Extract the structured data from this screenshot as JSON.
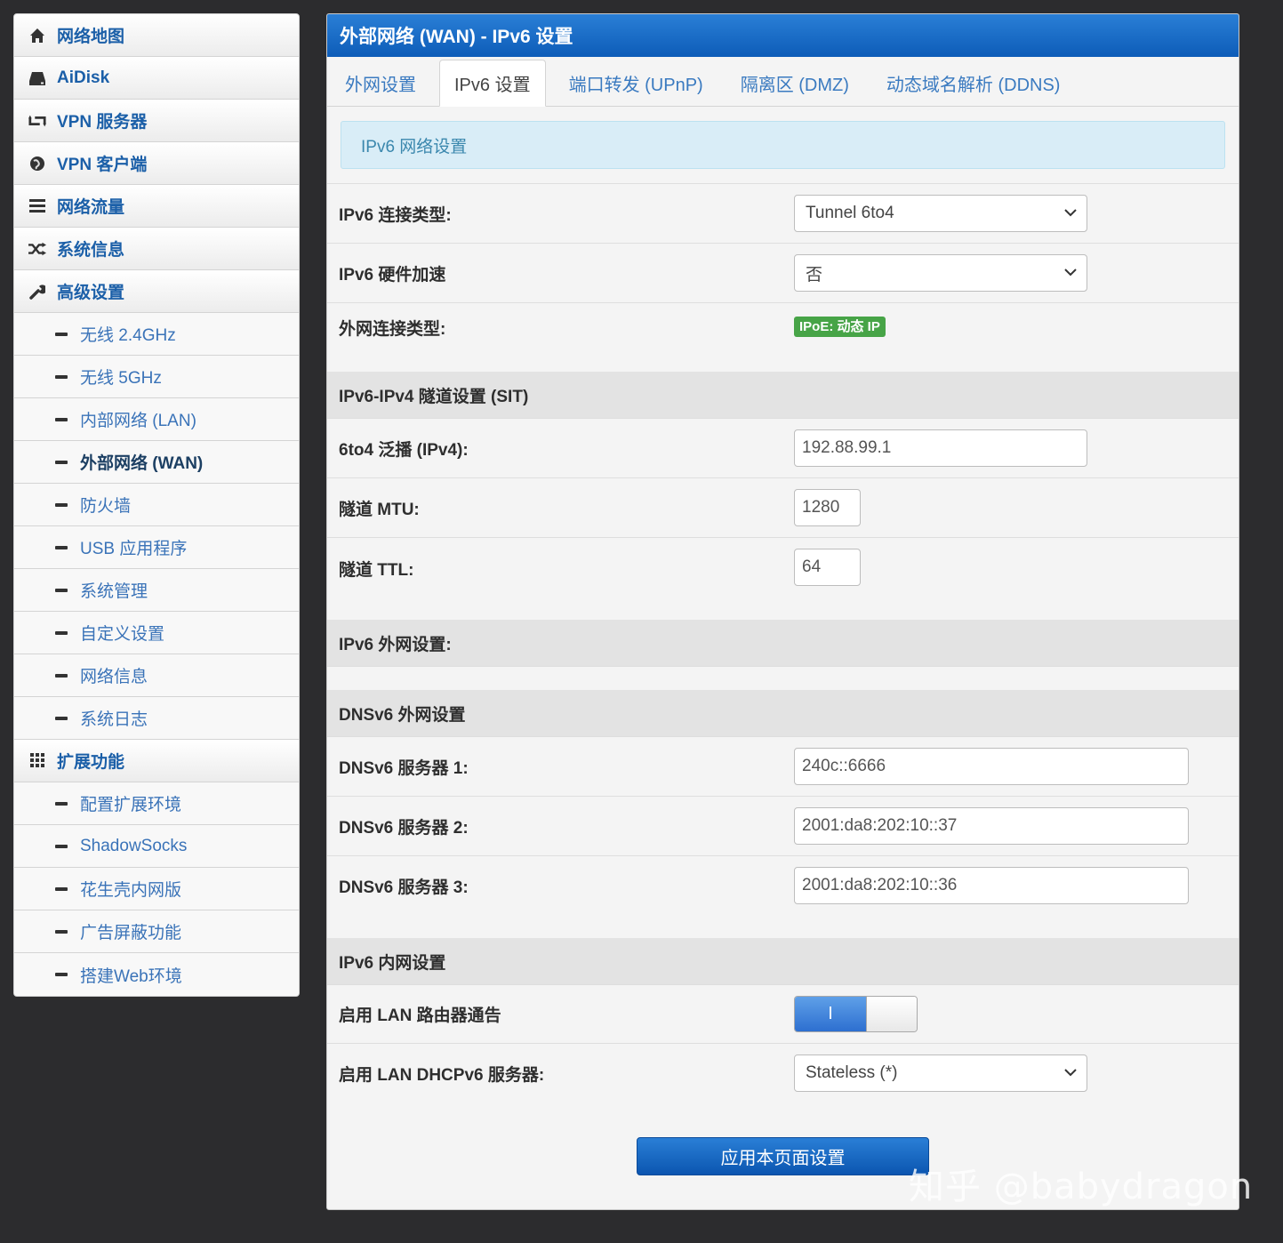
{
  "sidebar": {
    "items": [
      {
        "label": "网络地图",
        "icon": "home-icon"
      },
      {
        "label": "AiDisk",
        "icon": "disk-icon"
      },
      {
        "label": "VPN 服务器",
        "icon": "retweet-icon"
      },
      {
        "label": "VPN 客户端",
        "icon": "globe-icon"
      },
      {
        "label": "网络流量",
        "icon": "list-icon"
      },
      {
        "label": "系统信息",
        "icon": "shuffle-icon"
      },
      {
        "label": "高级设置",
        "icon": "wrench-icon"
      }
    ],
    "advanced": [
      "无线 2.4GHz",
      "无线 5GHz",
      "内部网络 (LAN)",
      "外部网络 (WAN)",
      "防火墙",
      "USB 应用程序",
      "系统管理",
      "自定义设置",
      "网络信息",
      "系统日志"
    ],
    "extensions_label": "扩展功能",
    "extensions": [
      "配置扩展环境",
      "ShadowSocks",
      "花生壳内网版",
      "广告屏蔽功能",
      "搭建Web环境"
    ]
  },
  "panel": {
    "title": "外部网络 (WAN) - IPv6 设置",
    "tabs": [
      "外网设置",
      "IPv6 设置",
      "端口转发 (UPnP)",
      "隔离区 (DMZ)",
      "动态域名解析 (DDNS)"
    ],
    "active_tab": "IPv6 设置",
    "info": "IPv6 网络设置"
  },
  "form": {
    "conn_type_label": "IPv6 连接类型:",
    "conn_type_value": "Tunnel 6to4",
    "hw_accel_label": "IPv6 硬件加速",
    "hw_accel_value": "否",
    "wan_type_label": "外网连接类型:",
    "wan_type_badge": "IPoE: 动态 IP",
    "sit_section": "IPv6-IPv4 隧道设置 (SIT)",
    "relay_label": "6to4 泛播 (IPv4):",
    "relay_value": "192.88.99.1",
    "mtu_label": "隧道 MTU:",
    "mtu_value": "1280",
    "ttl_label": "隧道 TTL:",
    "ttl_value": "64",
    "wan_section": "IPv6 外网设置:",
    "dns_section": "DNSv6 外网设置",
    "dns1_label": "DNSv6 服务器 1:",
    "dns1_value": "240c::6666",
    "dns2_label": "DNSv6 服务器 2:",
    "dns2_value": "2001:da8:202:10::37",
    "dns3_label": "DNSv6 服务器 3:",
    "dns3_value": "2001:da8:202:10::36",
    "lan_section": "IPv6 内网设置",
    "ra_label": "启用 LAN 路由器通告",
    "ra_toggle_on": "I",
    "dhcp_label": "启用 LAN DHCPv6 服务器:",
    "dhcp_value": "Stateless (*)",
    "apply_label": "应用本页面设置"
  },
  "watermark": "知乎 @babydragon",
  "colors": {
    "header_blue": "#1565c0",
    "link_blue": "#3a73b8",
    "badge_green": "#47a447",
    "info_bg": "#d9edf7"
  }
}
